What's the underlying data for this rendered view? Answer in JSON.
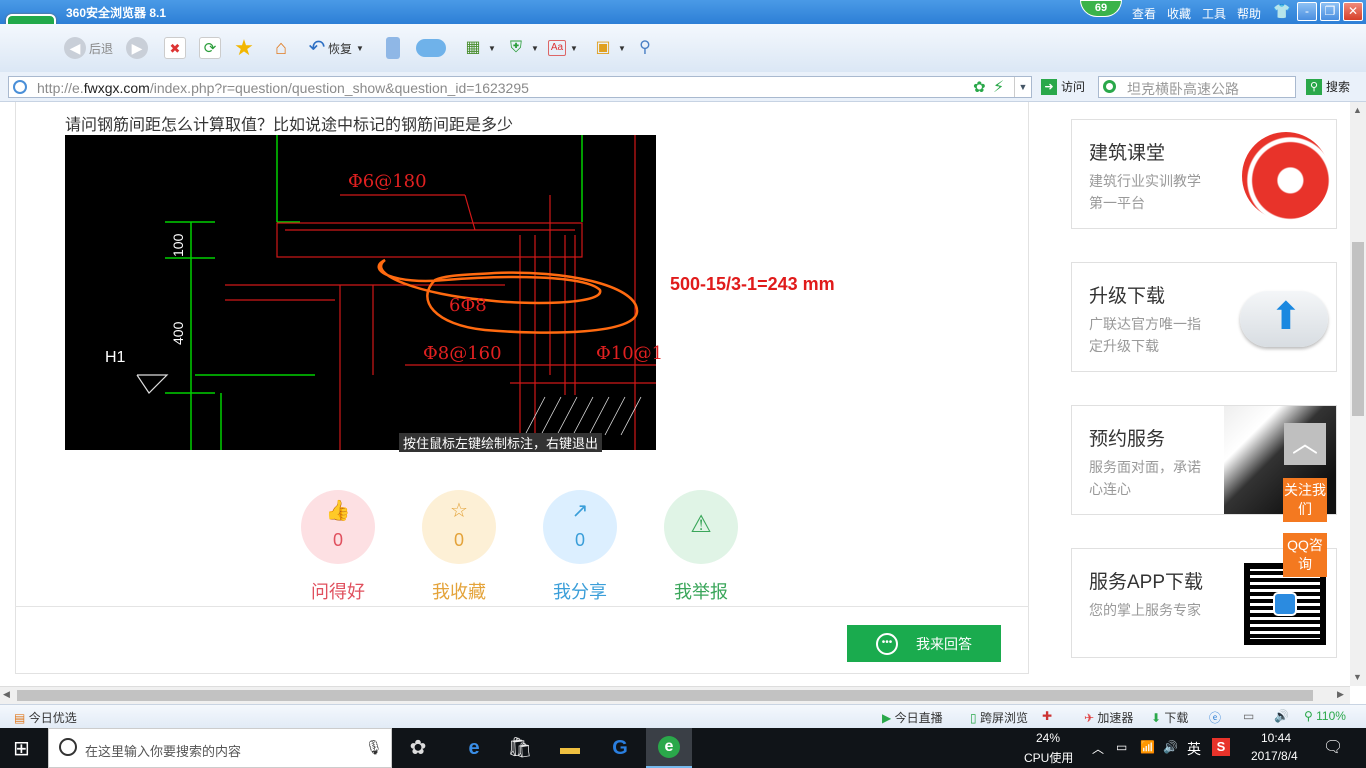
{
  "browser": {
    "title": "360安全浏览器 8.1",
    "badge": "69",
    "menu": [
      "查看",
      "收藏",
      "工具",
      "帮助"
    ],
    "window_buttons": [
      "-",
      "❐",
      "✕"
    ]
  },
  "toolbar": {
    "back_label": "后退",
    "restore_label": "恢复"
  },
  "address": {
    "url_prefix": "http://e.",
    "url_domain": "fwxgx.com",
    "url_rest": "/index.php?r=question/question_show&question_id=1623295",
    "visit_label": "访问",
    "search_placeholder": "坦克横卧高速公路",
    "search_button": "搜索"
  },
  "question": {
    "title": "请问钢筋间距怎么计算取值？比如说途中标记的钢筋间距是多少",
    "answer_formula": "500-15/3-1=243 mm",
    "cad": {
      "dim_100": "100",
      "dim_400": "400",
      "label_h1": "H1",
      "rebar_top": "Φ6@180",
      "rebar_circled": "6Φ8",
      "rebar_mid": "Φ8@160",
      "rebar_right": "Φ10@1",
      "status_hint": "按住鼠标左键绘制标注，右键退出"
    }
  },
  "actions": [
    {
      "label": "问得好",
      "count": "0",
      "icon": "thumbs-up-icon",
      "color": "#e0505e",
      "bg": "#fde0e3"
    },
    {
      "label": "我收藏",
      "count": "0",
      "icon": "star-icon",
      "color": "#e4a33a",
      "bg": "#fdf0d6"
    },
    {
      "label": "我分享",
      "count": "0",
      "icon": "share-icon",
      "color": "#3a9ed9",
      "bg": "#dcefff"
    },
    {
      "label": "我举报",
      "count": "",
      "icon": "warning-icon",
      "color": "#3aa65a",
      "bg": "#e0f4e6"
    }
  ],
  "reply_button": "我来回答",
  "sidebar": [
    {
      "title": "建筑课堂",
      "desc": "建筑行业实训教学第一平台"
    },
    {
      "title": "升级下载",
      "desc": "广联达官方唯一指定升级下载"
    },
    {
      "title": "预约服务",
      "desc": "服务面对面，承诺心连心"
    },
    {
      "title": "服务APP下载",
      "desc": "您的掌上服务专家"
    }
  ],
  "float": {
    "follow": "关注我们",
    "qq": "QQ咨询"
  },
  "status": {
    "today_pick": "今日优选",
    "live": "今日直播",
    "cross": "跨屏浏览",
    "accelerator": "加速器",
    "download": "下载",
    "zoom": "110%"
  },
  "taskbar": {
    "search_placeholder": "在这里输入你要搜索的内容",
    "cpu_percent": "24%",
    "cpu_label": "CPU使用",
    "ime": "英",
    "time": "10:44",
    "date": "2017/8/4"
  }
}
